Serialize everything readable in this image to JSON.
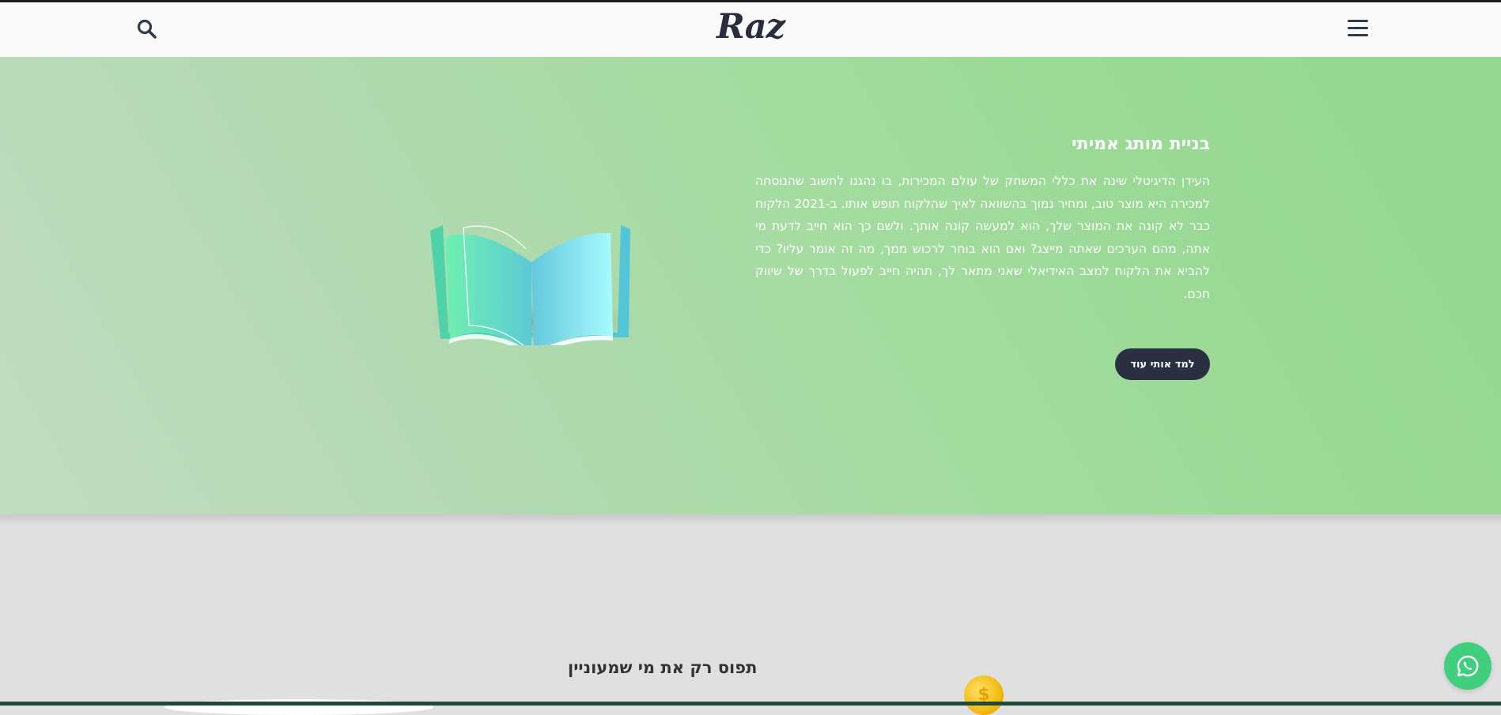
{
  "header": {
    "logo": "Raz",
    "search_icon": "search-icon",
    "menu_icon": "hamburger-menu-icon"
  },
  "hero": {
    "title": "בניית מותג אמיתי",
    "paragraph": "העידן הדיגיטלי שינה את כללי המשחק של עולם המכירות, בו נהגנו לחשוב שהנוסחה למכירה היא מוצר טוב, ומחיר נמוך בהשוואה לאיך שהלקוח תופש אותו. ב-2021 הלקוח כבר לא קונה את המוצר שלך, הוא למעשה קונה אותך. ולשם כך הוא חייב לדעת מי אתה, מהם הערכים שאתה מייצג? ואם הוא בוחר לרכוש ממך, מה זה אומר עליו? כדי להביא את הלקוח למצב האידיאלי שאני מתאר לך, תהיה חייב לפעול בדרך של שיווק חכם.",
    "cta_label": "למד אותי עוד",
    "illustration": "open-book-icon"
  },
  "section2": {
    "title": "תפוס רק את מי שמעוניין",
    "coin_symbol": "$"
  },
  "floating": {
    "whatsapp_icon": "whatsapp-icon"
  },
  "colors": {
    "hero_green": "#9ad996",
    "button_dark": "#2b2f42",
    "whatsapp_green": "#3fcf7f",
    "page_gray": "#e0e0e0"
  }
}
